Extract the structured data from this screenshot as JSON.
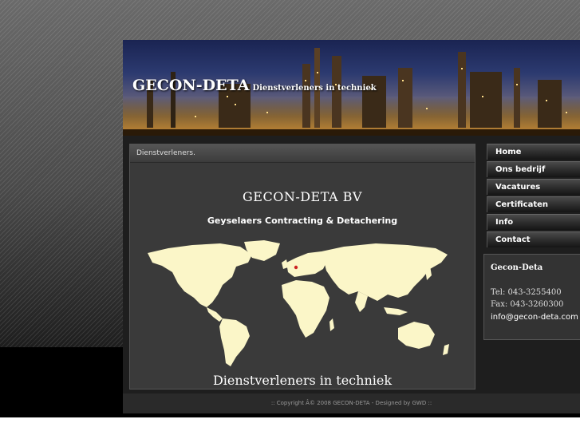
{
  "header": {
    "title": "GECON-DETA",
    "tagline": "Dienstverleners in techniek"
  },
  "content": {
    "bar_title": "Dienstverleners.",
    "company_name": "GECON-DETA   BV",
    "company_subtitle": "Geyselaers Contracting & Detachering",
    "bottom_text": "Dienstverleners in techniek"
  },
  "nav": {
    "items": [
      {
        "label": "Home"
      },
      {
        "label": "Ons bedrijf"
      },
      {
        "label": "Vacatures"
      },
      {
        "label": "Certificaten"
      },
      {
        "label": "Info"
      },
      {
        "label": "Contact"
      }
    ]
  },
  "contact": {
    "title": "Gecon-Deta",
    "tel": "Tel:  043-3255400",
    "fax": "Fax: 043-3260300",
    "email": "info@gecon-deta.com"
  },
  "footer": {
    "copyright": ":: Copyright Â© 2008 GECON-DETA - Designed by GWD ::"
  },
  "colors": {
    "map_land": "#fbf6c8",
    "map_marker": "#cc2222",
    "page_background": "#1e1e1e"
  }
}
